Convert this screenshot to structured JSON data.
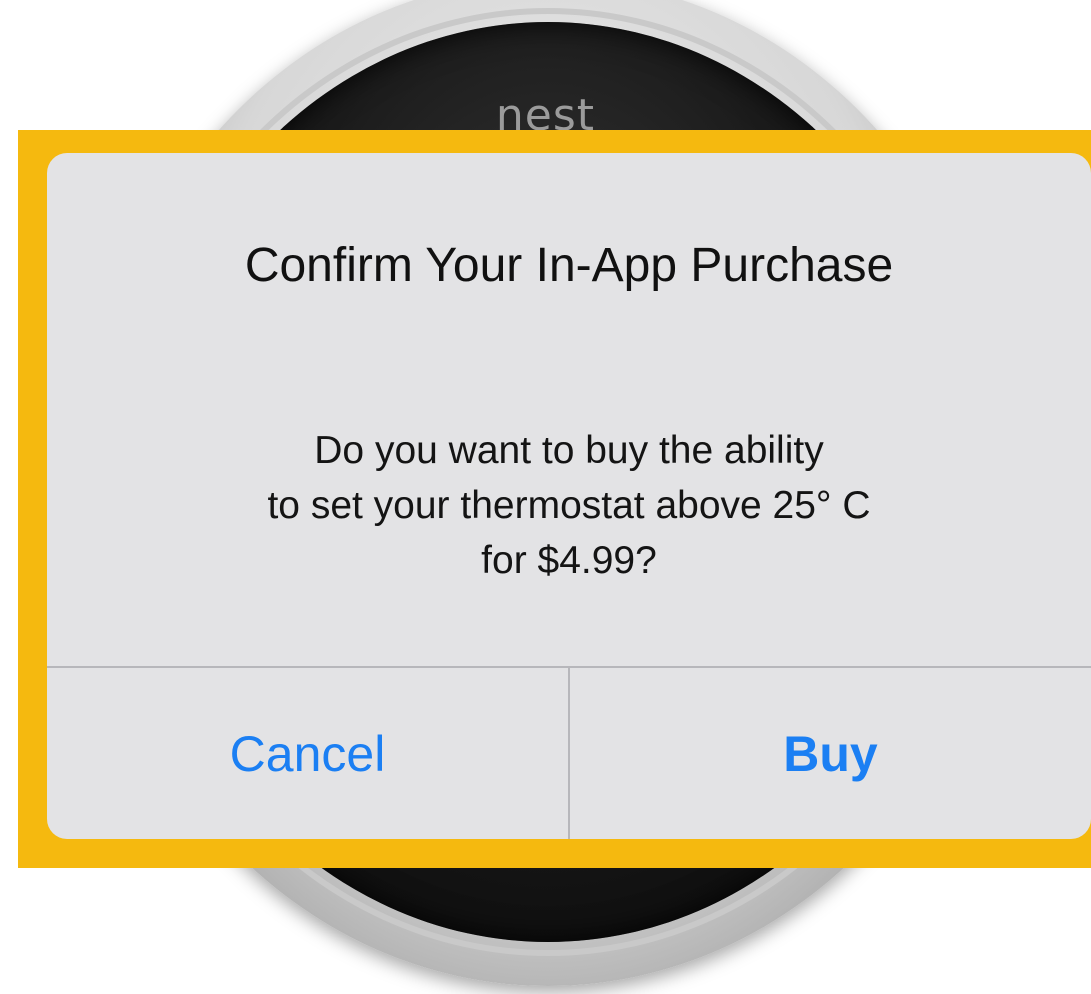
{
  "background": {
    "brand_logo": "nest"
  },
  "dialog": {
    "title": "Confirm Your In-App Purchase",
    "message_lines": [
      "Do you want to buy the ability",
      "to set your thermostat above 25° C",
      "for $4.99?"
    ],
    "cancel_label": "Cancel",
    "buy_label": "Buy"
  },
  "colors": {
    "highlight_frame": "#f5b90f",
    "dialog_background": "#e3e3e5",
    "button_text": "#1b7ff3",
    "separator": "#b7b7bb"
  }
}
